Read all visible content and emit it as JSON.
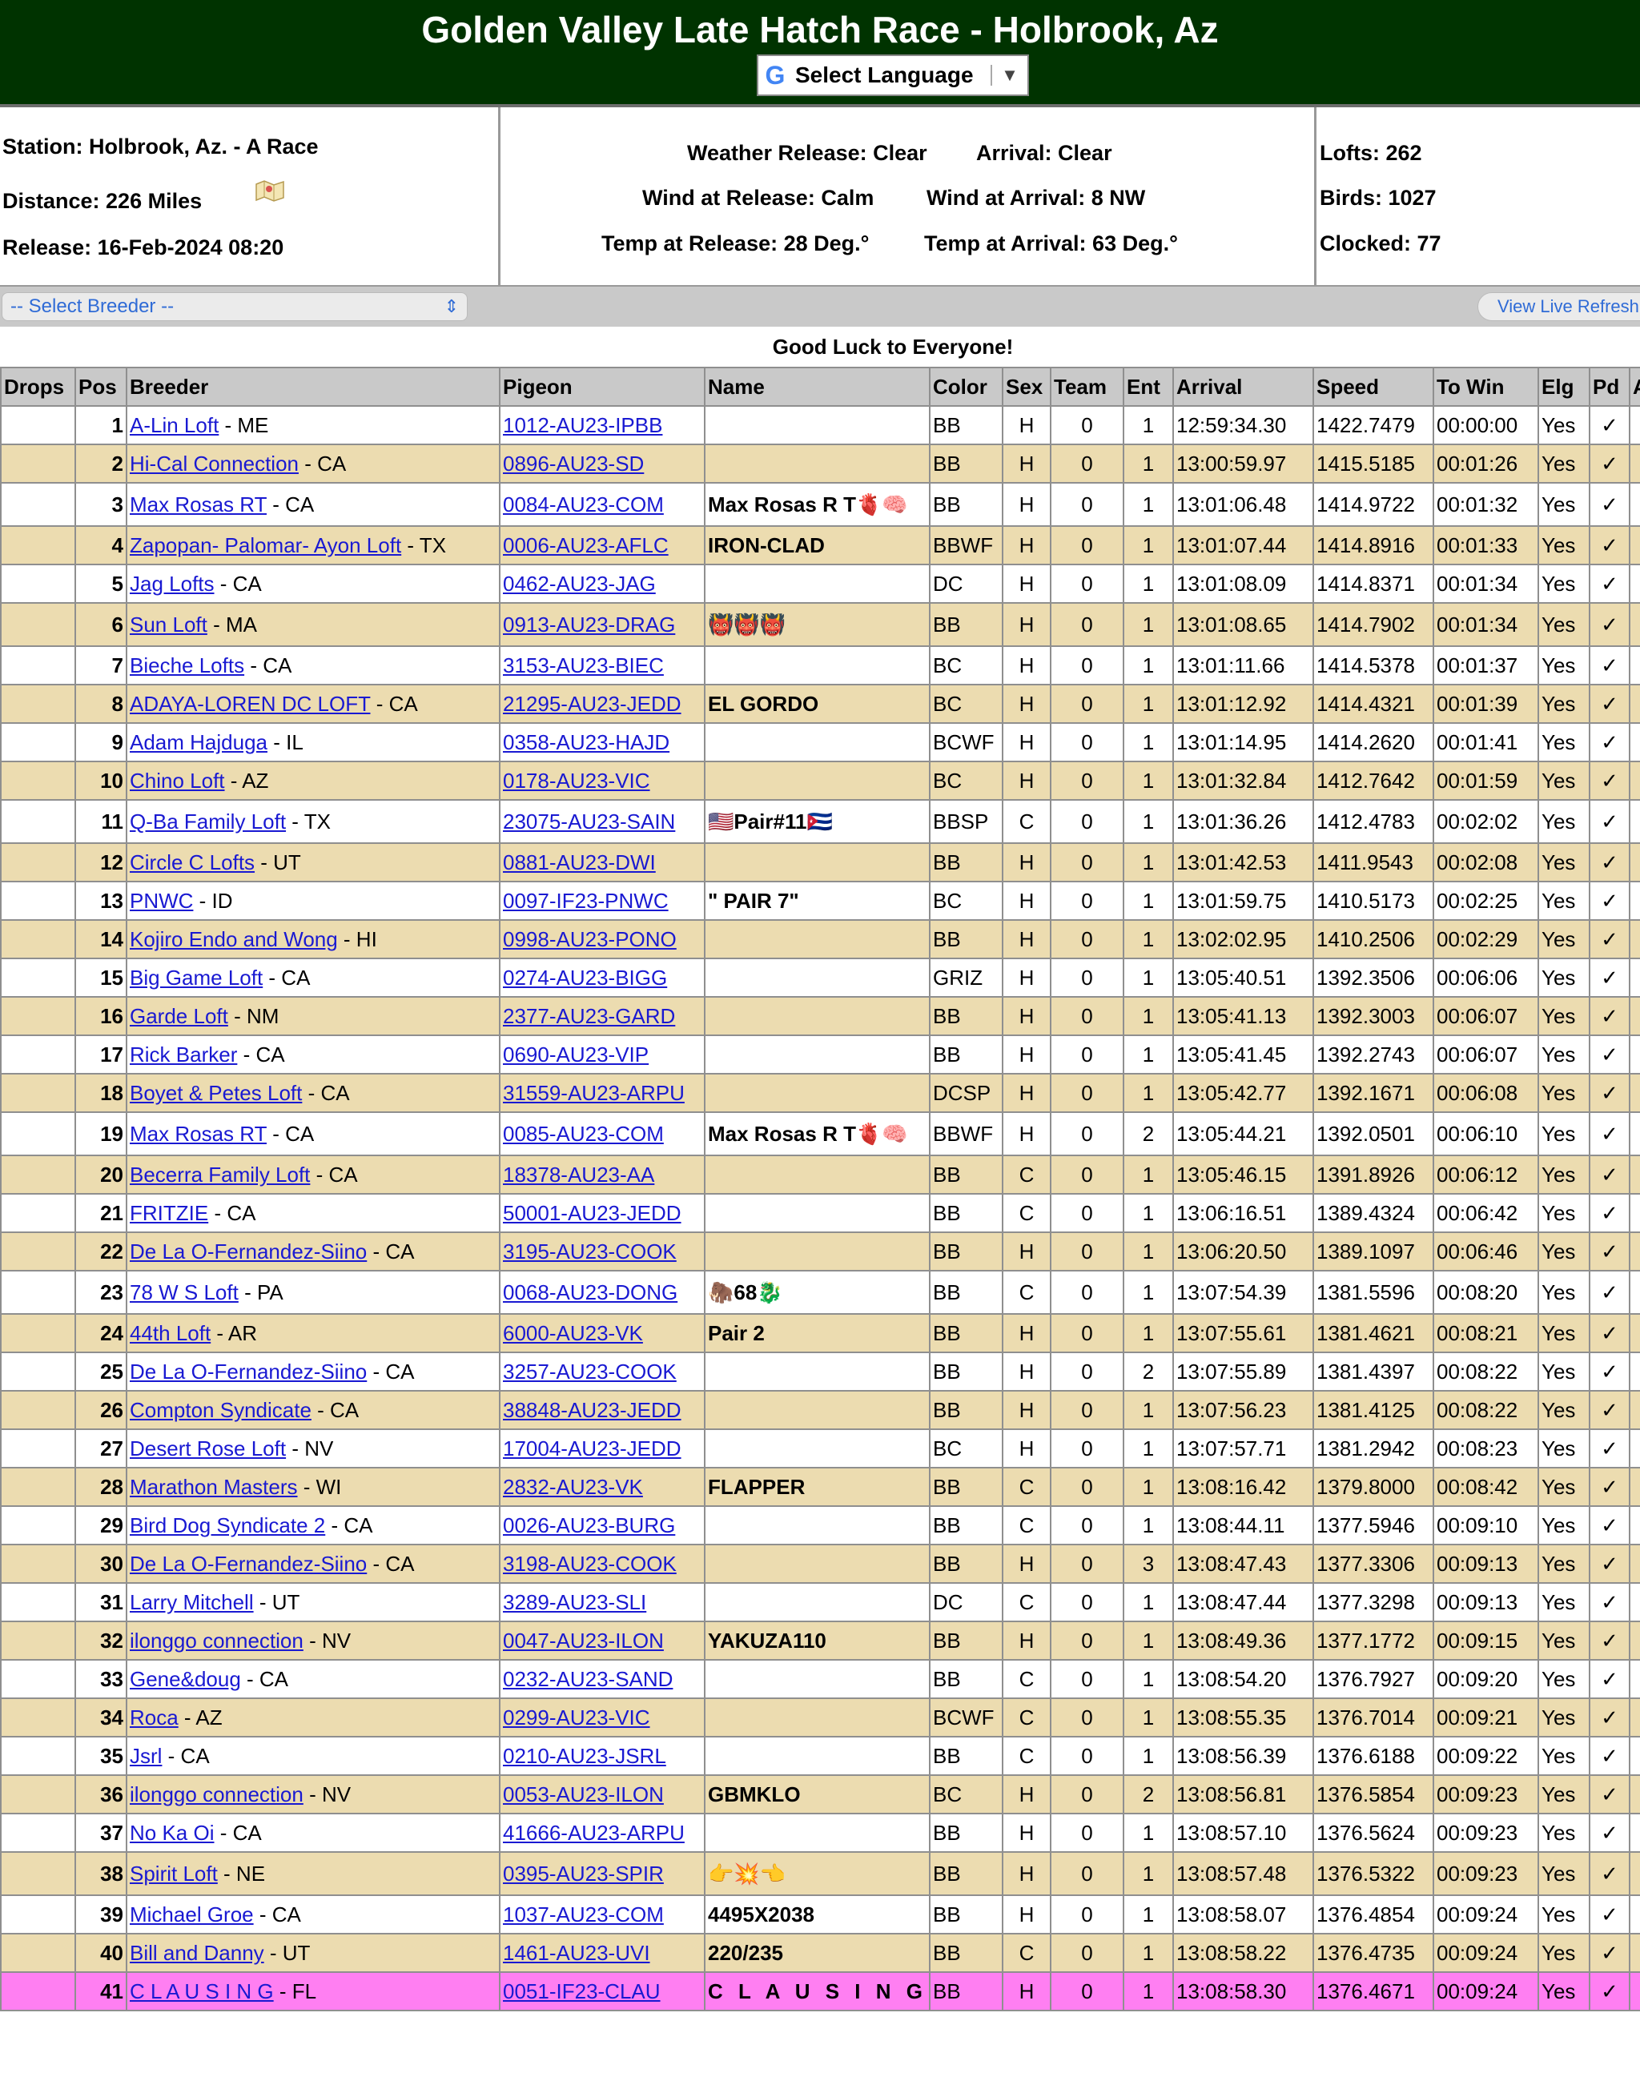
{
  "header": {
    "title": "Golden Valley Late Hatch Race - Holbrook, Az",
    "language_button": "Select Language",
    "language_logo": "G",
    "language_arrow": "▼"
  },
  "info": {
    "station": "Station: Holbrook, Az. - A Race",
    "distance": "Distance: 226 Miles",
    "release": "Release: 16-Feb-2024 08:20",
    "weather_release": "Weather Release: Clear",
    "arrival": "Arrival: Clear",
    "wind_release": "Wind at Release: Calm",
    "wind_arrival": "Wind at Arrival: 8 NW",
    "temp_release": "Temp at Release: 28 Deg.°",
    "temp_arrival": "Temp at Arrival: 63 Deg.°",
    "lofts": "Lofts: 262",
    "birds": "Birds: 1027",
    "clocked": "Clocked: 77"
  },
  "toolbar": {
    "breeder_select": "-- Select Breeder --",
    "live_refresh": "View Live Refresh"
  },
  "message": "Good Luck to Everyone!",
  "table": {
    "columns": [
      "Drops",
      "Pos",
      "Breeder",
      "Pigeon",
      "Name",
      "Color",
      "Sex",
      "Team",
      "Ent",
      "Arrival",
      "Speed",
      "To Win",
      "Elg",
      "Pd",
      "A"
    ],
    "rows": [
      {
        "pos": "1",
        "breeder": "A-Lin Loft",
        "state": " - ME",
        "pigeon": "1012-AU23-IPBB",
        "name": "",
        "color": "BB",
        "sex": "H",
        "team": "0",
        "ent": "1",
        "arrival": "12:59:34.30",
        "speed": "1422.7479",
        "to_win": "00:00:00",
        "elg": "Yes",
        "pd": "✓"
      },
      {
        "pos": "2",
        "breeder": "Hi-Cal Connection",
        "state": " - CA",
        "pigeon": "0896-AU23-SD",
        "name": "",
        "color": "BB",
        "sex": "H",
        "team": "0",
        "ent": "1",
        "arrival": "13:00:59.97",
        "speed": "1415.5185",
        "to_win": "00:01:26",
        "elg": "Yes",
        "pd": "✓"
      },
      {
        "pos": "3",
        "breeder": "Max Rosas RT",
        "state": " - CA",
        "pigeon": "0084-AU23-COM",
        "name": "Max Rosas R T🫀🧠",
        "color": "BB",
        "sex": "H",
        "team": "0",
        "ent": "1",
        "arrival": "13:01:06.48",
        "speed": "1414.9722",
        "to_win": "00:01:32",
        "elg": "Yes",
        "pd": "✓"
      },
      {
        "pos": "4",
        "breeder": "Zapopan- Palomar- Ayon Loft",
        "state": " - TX",
        "pigeon": "0006-AU23-AFLC",
        "name": "IRON-CLAD",
        "color": "BBWF",
        "sex": "H",
        "team": "0",
        "ent": "1",
        "arrival": "13:01:07.44",
        "speed": "1414.8916",
        "to_win": "00:01:33",
        "elg": "Yes",
        "pd": "✓"
      },
      {
        "pos": "5",
        "breeder": "Jag Lofts",
        "state": " - CA",
        "pigeon": "0462-AU23-JAG",
        "name": "",
        "color": "DC",
        "sex": "H",
        "team": "0",
        "ent": "1",
        "arrival": "13:01:08.09",
        "speed": "1414.8371",
        "to_win": "00:01:34",
        "elg": "Yes",
        "pd": "✓"
      },
      {
        "pos": "6",
        "breeder": "Sun Loft",
        "state": " - MA",
        "pigeon": "0913-AU23-DRAG",
        "name": "👹👹👹",
        "color": "BB",
        "sex": "H",
        "team": "0",
        "ent": "1",
        "arrival": "13:01:08.65",
        "speed": "1414.7902",
        "to_win": "00:01:34",
        "elg": "Yes",
        "pd": "✓"
      },
      {
        "pos": "7",
        "breeder": "Bieche Lofts",
        "state": " - CA",
        "pigeon": "3153-AU23-BIEC",
        "name": "",
        "color": "BC",
        "sex": "H",
        "team": "0",
        "ent": "1",
        "arrival": "13:01:11.66",
        "speed": "1414.5378",
        "to_win": "00:01:37",
        "elg": "Yes",
        "pd": "✓"
      },
      {
        "pos": "8",
        "breeder": "ADAYA-LOREN DC LOFT",
        "state": " - CA",
        "pigeon": "21295-AU23-JEDD",
        "name": "EL GORDO",
        "color": "BC",
        "sex": "H",
        "team": "0",
        "ent": "1",
        "arrival": "13:01:12.92",
        "speed": "1414.4321",
        "to_win": "00:01:39",
        "elg": "Yes",
        "pd": "✓"
      },
      {
        "pos": "9",
        "breeder": "Adam Hajduga",
        "state": " - IL",
        "pigeon": "0358-AU23-HAJD",
        "name": "",
        "color": "BCWF",
        "sex": "H",
        "team": "0",
        "ent": "1",
        "arrival": "13:01:14.95",
        "speed": "1414.2620",
        "to_win": "00:01:41",
        "elg": "Yes",
        "pd": "✓"
      },
      {
        "pos": "10",
        "breeder": "Chino Loft",
        "state": " - AZ",
        "pigeon": "0178-AU23-VIC",
        "name": "",
        "color": "BC",
        "sex": "H",
        "team": "0",
        "ent": "1",
        "arrival": "13:01:32.84",
        "speed": "1412.7642",
        "to_win": "00:01:59",
        "elg": "Yes",
        "pd": "✓"
      },
      {
        "pos": "11",
        "breeder": "Q-Ba Family Loft",
        "state": " - TX",
        "pigeon": "23075-AU23-SAIN",
        "name": "🇺🇸Pair#11🇨🇺",
        "color": "BBSP",
        "sex": "C",
        "team": "0",
        "ent": "1",
        "arrival": "13:01:36.26",
        "speed": "1412.4783",
        "to_win": "00:02:02",
        "elg": "Yes",
        "pd": "✓"
      },
      {
        "pos": "12",
        "breeder": "Circle C Lofts",
        "state": " - UT",
        "pigeon": "0881-AU23-DWI",
        "name": "",
        "color": "BB",
        "sex": "H",
        "team": "0",
        "ent": "1",
        "arrival": "13:01:42.53",
        "speed": "1411.9543",
        "to_win": "00:02:08",
        "elg": "Yes",
        "pd": "✓"
      },
      {
        "pos": "13",
        "breeder": "PNWC",
        "state": " - ID",
        "pigeon": "0097-IF23-PNWC",
        "name": "\" PAIR 7\"",
        "color": "BC",
        "sex": "H",
        "team": "0",
        "ent": "1",
        "arrival": "13:01:59.75",
        "speed": "1410.5173",
        "to_win": "00:02:25",
        "elg": "Yes",
        "pd": "✓"
      },
      {
        "pos": "14",
        "breeder": "Kojiro Endo and Wong",
        "state": " - HI",
        "pigeon": "0998-AU23-PONO",
        "name": "",
        "color": "BB",
        "sex": "H",
        "team": "0",
        "ent": "1",
        "arrival": "13:02:02.95",
        "speed": "1410.2506",
        "to_win": "00:02:29",
        "elg": "Yes",
        "pd": "✓"
      },
      {
        "pos": "15",
        "breeder": "Big Game Loft",
        "state": " - CA",
        "pigeon": "0274-AU23-BIGG",
        "name": "",
        "color": "GRIZ",
        "sex": "H",
        "team": "0",
        "ent": "1",
        "arrival": "13:05:40.51",
        "speed": "1392.3506",
        "to_win": "00:06:06",
        "elg": "Yes",
        "pd": "✓"
      },
      {
        "pos": "16",
        "breeder": "Garde Loft",
        "state": " - NM",
        "pigeon": "2377-AU23-GARD",
        "name": "",
        "color": "BB",
        "sex": "H",
        "team": "0",
        "ent": "1",
        "arrival": "13:05:41.13",
        "speed": "1392.3003",
        "to_win": "00:06:07",
        "elg": "Yes",
        "pd": "✓"
      },
      {
        "pos": "17",
        "breeder": "Rick Barker",
        "state": " - CA",
        "pigeon": "0690-AU23-VIP",
        "name": "",
        "color": "BB",
        "sex": "H",
        "team": "0",
        "ent": "1",
        "arrival": "13:05:41.45",
        "speed": "1392.2743",
        "to_win": "00:06:07",
        "elg": "Yes",
        "pd": "✓"
      },
      {
        "pos": "18",
        "breeder": "Boyet & Petes Loft",
        "state": " - CA",
        "pigeon": "31559-AU23-ARPU",
        "name": "",
        "color": "DCSP",
        "sex": "H",
        "team": "0",
        "ent": "1",
        "arrival": "13:05:42.77",
        "speed": "1392.1671",
        "to_win": "00:06:08",
        "elg": "Yes",
        "pd": "✓"
      },
      {
        "pos": "19",
        "breeder": "Max Rosas RT",
        "state": " - CA",
        "pigeon": "0085-AU23-COM",
        "name": "Max Rosas R T🫀🧠",
        "color": "BBWF",
        "sex": "H",
        "team": "0",
        "ent": "2",
        "arrival": "13:05:44.21",
        "speed": "1392.0501",
        "to_win": "00:06:10",
        "elg": "Yes",
        "pd": "✓"
      },
      {
        "pos": "20",
        "breeder": "Becerra Family Loft",
        "state": " - CA",
        "pigeon": "18378-AU23-AA",
        "name": "",
        "color": "BB",
        "sex": "C",
        "team": "0",
        "ent": "1",
        "arrival": "13:05:46.15",
        "speed": "1391.8926",
        "to_win": "00:06:12",
        "elg": "Yes",
        "pd": "✓"
      },
      {
        "pos": "21",
        "breeder": "FRITZIE",
        "state": " - CA",
        "pigeon": "50001-AU23-JEDD",
        "name": "",
        "color": "BB",
        "sex": "C",
        "team": "0",
        "ent": "1",
        "arrival": "13:06:16.51",
        "speed": "1389.4324",
        "to_win": "00:06:42",
        "elg": "Yes",
        "pd": "✓"
      },
      {
        "pos": "22",
        "breeder": "De La O-Fernandez-Siino",
        "state": " - CA",
        "pigeon": "3195-AU23-COOK",
        "name": "",
        "color": "BB",
        "sex": "H",
        "team": "0",
        "ent": "1",
        "arrival": "13:06:20.50",
        "speed": "1389.1097",
        "to_win": "00:06:46",
        "elg": "Yes",
        "pd": "✓"
      },
      {
        "pos": "23",
        "breeder": "78 W S Loft",
        "state": " - PA",
        "pigeon": "0068-AU23-DONG",
        "name": "🦣68🐉",
        "color": "BB",
        "sex": "C",
        "team": "0",
        "ent": "1",
        "arrival": "13:07:54.39",
        "speed": "1381.5596",
        "to_win": "00:08:20",
        "elg": "Yes",
        "pd": "✓"
      },
      {
        "pos": "24",
        "breeder": "44th Loft",
        "state": " - AR",
        "pigeon": "6000-AU23-VK",
        "name": "Pair 2",
        "color": "BB",
        "sex": "H",
        "team": "0",
        "ent": "1",
        "arrival": "13:07:55.61",
        "speed": "1381.4621",
        "to_win": "00:08:21",
        "elg": "Yes",
        "pd": "✓"
      },
      {
        "pos": "25",
        "breeder": "De La O-Fernandez-Siino",
        "state": " - CA",
        "pigeon": "3257-AU23-COOK",
        "name": "",
        "color": "BB",
        "sex": "H",
        "team": "0",
        "ent": "2",
        "arrival": "13:07:55.89",
        "speed": "1381.4397",
        "to_win": "00:08:22",
        "elg": "Yes",
        "pd": "✓"
      },
      {
        "pos": "26",
        "breeder": "Compton Syndicate",
        "state": " - CA",
        "pigeon": "38848-AU23-JEDD",
        "name": "",
        "color": "BB",
        "sex": "H",
        "team": "0",
        "ent": "1",
        "arrival": "13:07:56.23",
        "speed": "1381.4125",
        "to_win": "00:08:22",
        "elg": "Yes",
        "pd": "✓"
      },
      {
        "pos": "27",
        "breeder": "Desert Rose Loft",
        "state": " - NV",
        "pigeon": "17004-AU23-JEDD",
        "name": "",
        "color": "BC",
        "sex": "H",
        "team": "0",
        "ent": "1",
        "arrival": "13:07:57.71",
        "speed": "1381.2942",
        "to_win": "00:08:23",
        "elg": "Yes",
        "pd": "✓"
      },
      {
        "pos": "28",
        "breeder": "Marathon Masters",
        "state": " - WI",
        "pigeon": "2832-AU23-VK",
        "name": "FLAPPER",
        "color": "BB",
        "sex": "C",
        "team": "0",
        "ent": "1",
        "arrival": "13:08:16.42",
        "speed": "1379.8000",
        "to_win": "00:08:42",
        "elg": "Yes",
        "pd": "✓"
      },
      {
        "pos": "29",
        "breeder": "Bird Dog Syndicate 2",
        "state": " - CA",
        "pigeon": "0026-AU23-BURG",
        "name": "",
        "color": "BB",
        "sex": "C",
        "team": "0",
        "ent": "1",
        "arrival": "13:08:44.11",
        "speed": "1377.5946",
        "to_win": "00:09:10",
        "elg": "Yes",
        "pd": "✓"
      },
      {
        "pos": "30",
        "breeder": "De La O-Fernandez-Siino",
        "state": " - CA",
        "pigeon": "3198-AU23-COOK",
        "name": "",
        "color": "BB",
        "sex": "H",
        "team": "0",
        "ent": "3",
        "arrival": "13:08:47.43",
        "speed": "1377.3306",
        "to_win": "00:09:13",
        "elg": "Yes",
        "pd": "✓"
      },
      {
        "pos": "31",
        "breeder": "Larry Mitchell",
        "state": " - UT",
        "pigeon": "3289-AU23-SLI",
        "name": "",
        "color": "DC",
        "sex": "C",
        "team": "0",
        "ent": "1",
        "arrival": "13:08:47.44",
        "speed": "1377.3298",
        "to_win": "00:09:13",
        "elg": "Yes",
        "pd": "✓"
      },
      {
        "pos": "32",
        "breeder": "ilonggo connection",
        "state": " - NV",
        "pigeon": "0047-AU23-ILON",
        "name": "YAKUZA110",
        "color": "BB",
        "sex": "H",
        "team": "0",
        "ent": "1",
        "arrival": "13:08:49.36",
        "speed": "1377.1772",
        "to_win": "00:09:15",
        "elg": "Yes",
        "pd": "✓"
      },
      {
        "pos": "33",
        "breeder": "Gene&doug",
        "state": " - CA",
        "pigeon": "0232-AU23-SAND",
        "name": "",
        "color": "BB",
        "sex": "C",
        "team": "0",
        "ent": "1",
        "arrival": "13:08:54.20",
        "speed": "1376.7927",
        "to_win": "00:09:20",
        "elg": "Yes",
        "pd": "✓"
      },
      {
        "pos": "34",
        "breeder": "Roca",
        "state": " - AZ",
        "pigeon": "0299-AU23-VIC",
        "name": "",
        "color": "BCWF",
        "sex": "C",
        "team": "0",
        "ent": "1",
        "arrival": "13:08:55.35",
        "speed": "1376.7014",
        "to_win": "00:09:21",
        "elg": "Yes",
        "pd": "✓"
      },
      {
        "pos": "35",
        "breeder": "Jsrl",
        "state": " - CA",
        "pigeon": "0210-AU23-JSRL",
        "name": "",
        "color": "BB",
        "sex": "C",
        "team": "0",
        "ent": "1",
        "arrival": "13:08:56.39",
        "speed": "1376.6188",
        "to_win": "00:09:22",
        "elg": "Yes",
        "pd": "✓"
      },
      {
        "pos": "36",
        "breeder": "ilonggo connection",
        "state": " - NV",
        "pigeon": "0053-AU23-ILON",
        "name": "GBMKLO",
        "color": "BC",
        "sex": "H",
        "team": "0",
        "ent": "2",
        "arrival": "13:08:56.81",
        "speed": "1376.5854",
        "to_win": "00:09:23",
        "elg": "Yes",
        "pd": "✓"
      },
      {
        "pos": "37",
        "breeder": "No Ka Oi",
        "state": " - CA",
        "pigeon": "41666-AU23-ARPU",
        "name": "",
        "color": "BB",
        "sex": "H",
        "team": "0",
        "ent": "1",
        "arrival": "13:08:57.10",
        "speed": "1376.5624",
        "to_win": "00:09:23",
        "elg": "Yes",
        "pd": "✓"
      },
      {
        "pos": "38",
        "breeder": "Spirit Loft",
        "state": " - NE",
        "pigeon": "0395-AU23-SPIR",
        "name": "👉💥👈",
        "color": "BB",
        "sex": "H",
        "team": "0",
        "ent": "1",
        "arrival": "13:08:57.48",
        "speed": "1376.5322",
        "to_win": "00:09:23",
        "elg": "Yes",
        "pd": "✓"
      },
      {
        "pos": "39",
        "breeder": "Michael Groe",
        "state": " - CA",
        "pigeon": "1037-AU23-COM",
        "name": "4495X2038",
        "color": "BB",
        "sex": "H",
        "team": "0",
        "ent": "1",
        "arrival": "13:08:58.07",
        "speed": "1376.4854",
        "to_win": "00:09:24",
        "elg": "Yes",
        "pd": "✓"
      },
      {
        "pos": "40",
        "breeder": "Bill and Danny",
        "state": " - UT",
        "pigeon": "1461-AU23-UVI",
        "name": "220/235",
        "color": "BB",
        "sex": "C",
        "team": "0",
        "ent": "1",
        "arrival": "13:08:58.22",
        "speed": "1376.4735",
        "to_win": "00:09:24",
        "elg": "Yes",
        "pd": "✓"
      },
      {
        "pos": "41",
        "breeder": "C L A U S I N G",
        "state": " - FL",
        "pigeon": "0051-IF23-CLAU",
        "name": "C L A U S I N G",
        "color": "BB",
        "sex": "H",
        "team": "0",
        "ent": "1",
        "arrival": "13:08:58.30",
        "speed": "1376.4671",
        "to_win": "00:09:24",
        "elg": "Yes",
        "pd": "✓",
        "highlight": true
      }
    ]
  }
}
